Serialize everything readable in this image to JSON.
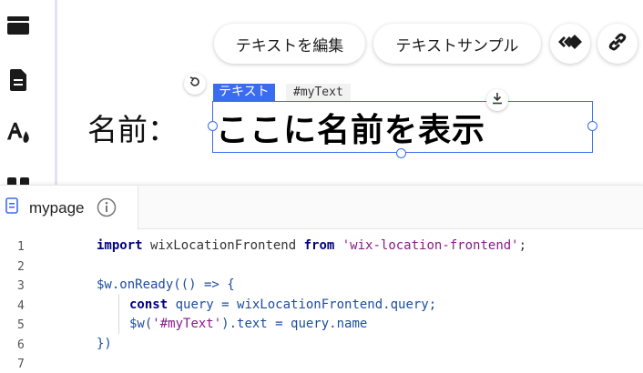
{
  "toolbar": {
    "edit_text_label": "テキストを編集",
    "text_sample_label": "テキストサンプル"
  },
  "canvas": {
    "name_label": "名前：",
    "selected_text": "ここに名前を表示",
    "element_type_tag": "テキスト",
    "element_id_tag": "#myText"
  },
  "editor": {
    "tab_name": "mypage",
    "line_numbers": [
      "1",
      "2",
      "3",
      "4",
      "5",
      "6",
      "7"
    ],
    "lines": {
      "l1_kw1": "import",
      "l1_id": " wixLocationFrontend ",
      "l1_kw2": "from",
      "l1_sp": " ",
      "l1_str": "'wix-location-frontend'",
      "l1_end": ";",
      "l3_a": "$w",
      "l3_b": ".onReady(() => {",
      "l4_kw": "const",
      "l4_rest": " query = wixLocationFrontend.query;",
      "l5_a": "$w(",
      "l5_str": "'#myText'",
      "l5_rest": ").text = query.name",
      "l6": "})"
    }
  },
  "colors": {
    "accent": "#3b6cf0",
    "keyword": "#000080",
    "string": "#8a1a8a"
  },
  "icons": [
    "panels-icon",
    "page-icon",
    "theme-icon",
    "apps-icon",
    "rotate-icon",
    "download-icon",
    "animation-icon",
    "link-icon",
    "page-file-icon",
    "info-icon"
  ]
}
